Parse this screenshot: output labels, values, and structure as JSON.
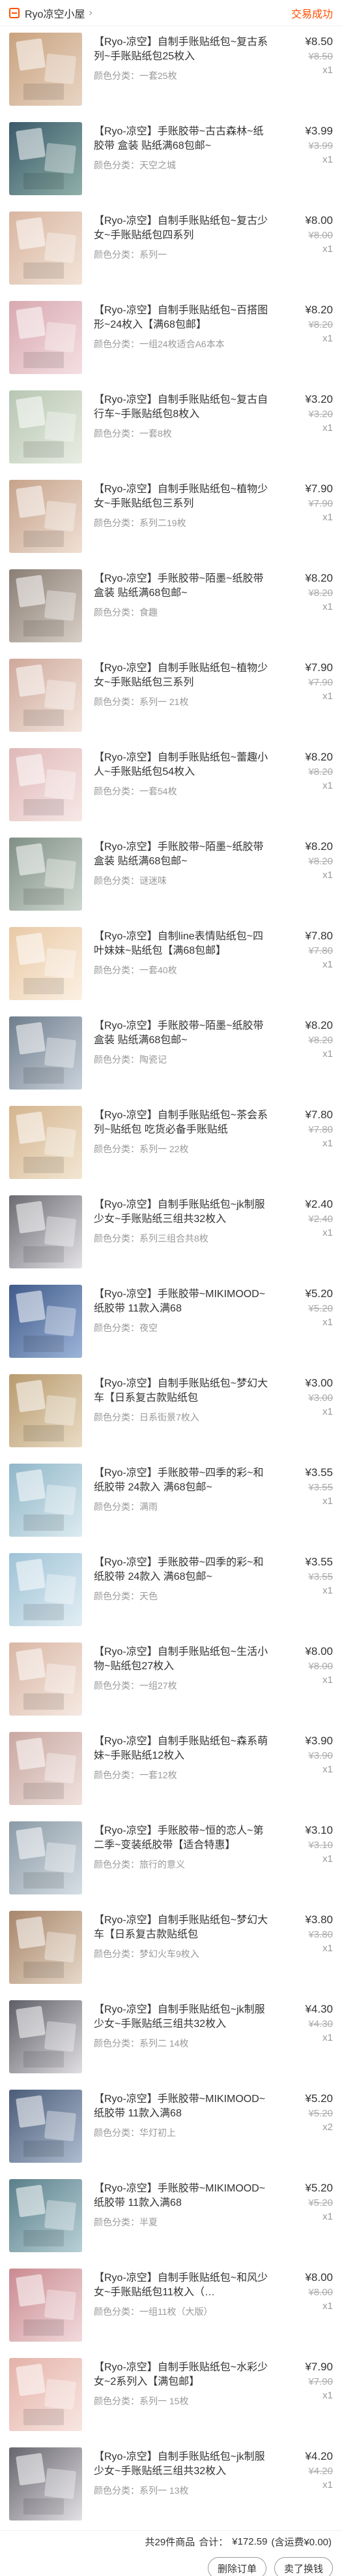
{
  "header": {
    "shop_name": "Ryo凉空小屋",
    "status": "交易成功"
  },
  "items": [
    {
      "title": "【Ryo-凉空】自制手账贴纸包~复古系列~手账贴纸包25枚入",
      "sku": "颜色分类：一套25枚",
      "price": "¥8.50",
      "orig": "¥8.50",
      "qty": "x1",
      "colors": [
        "#c9a27e",
        "#e8d5c4"
      ]
    },
    {
      "title": "【Ryo-凉空】手账胶带~古古森林~纸胶带 盒装 贴纸满68包邮~",
      "sku": "颜色分类：天空之城",
      "price": "¥3.99",
      "orig": "¥3.99",
      "qty": "x1",
      "colors": [
        "#3a5a6a",
        "#8fb0a8"
      ]
    },
    {
      "title": "【Ryo-凉空】自制手账贴纸包~复古少女~手账贴纸包四系列",
      "sku": "颜色分类：系列一",
      "price": "¥8.00",
      "orig": "¥8.00",
      "qty": "x1",
      "colors": [
        "#d9b5a0",
        "#f2e4d8"
      ]
    },
    {
      "title": "【Ryo-凉空】自制手账贴纸包~百搭图形~24枚入【满68包邮】",
      "sku": "颜色分类：一组24枚适合A6本本",
      "price": "¥8.20",
      "orig": "¥8.20",
      "qty": "x1",
      "colors": [
        "#d8a8b0",
        "#f4dfe2"
      ]
    },
    {
      "title": "【Ryo-凉空】自制手账贴纸包~复古自行车~手账贴纸包8枚入",
      "sku": "颜色分类：一套8枚",
      "price": "¥3.20",
      "orig": "¥3.20",
      "qty": "x1",
      "colors": [
        "#b7c6b2",
        "#e9ede2"
      ]
    },
    {
      "title": "【Ryo-凉空】自制手账贴纸包~植物少女~手账贴纸包三系列",
      "sku": "颜色分类：系列二19枚",
      "price": "¥7.90",
      "orig": "¥7.90",
      "qty": "x1",
      "colors": [
        "#c6a28a",
        "#efe0d4"
      ]
    },
    {
      "title": "【Ryo-凉空】手账胶带~陌墨~纸胶带盒装 贴纸满68包邮~",
      "sku": "颜色分类：食趣",
      "price": "¥8.20",
      "orig": "¥8.20",
      "qty": "x1",
      "colors": [
        "#8a7e74",
        "#d8cfc6"
      ]
    },
    {
      "title": "【Ryo-凉空】自制手账贴纸包~植物少女~手账贴纸包三系列",
      "sku": "颜色分类：系列一 21枚",
      "price": "¥7.90",
      "orig": "¥7.90",
      "qty": "x1",
      "colors": [
        "#cfa89a",
        "#f3e6de"
      ]
    },
    {
      "title": "【Ryo-凉空】自制手账贴纸包~蕾趣小人~手账贴纸包54枚入",
      "sku": "颜色分类：一套54枚",
      "price": "¥8.20",
      "orig": "¥8.20",
      "qty": "x1",
      "colors": [
        "#e0b8b8",
        "#f6e8e6"
      ]
    },
    {
      "title": "【Ryo-凉空】手账胶带~陌墨~纸胶带盒装 贴纸满68包邮~",
      "sku": "颜色分类：谜迷味",
      "price": "¥8.20",
      "orig": "¥8.20",
      "qty": "x1",
      "colors": [
        "#7f8f86",
        "#cfd8d0"
      ]
    },
    {
      "title": "【Ryo-凉空】自制line表情贴纸包~四叶妹妹~贴纸包【满68包邮】",
      "sku": "颜色分类：一套40枚",
      "price": "¥7.80",
      "orig": "¥7.80",
      "qty": "x1",
      "colors": [
        "#e9c9a6",
        "#fbf0e2"
      ]
    },
    {
      "title": "【Ryo-凉空】手账胶带~陌墨~纸胶带盒装 贴纸满68包邮~",
      "sku": "颜色分类：陶瓷记",
      "price": "¥8.20",
      "orig": "¥8.20",
      "qty": "x1",
      "colors": [
        "#6f7d8c",
        "#c9d2db"
      ]
    },
    {
      "title": "【Ryo-凉空】自制手账贴纸包~茶会系列~贴纸包 吃货必备手账贴纸",
      "sku": "颜色分类：系列一 22枚",
      "price": "¥7.80",
      "orig": "¥7.80",
      "qty": "x1",
      "colors": [
        "#d4b48e",
        "#f2e6d2"
      ]
    },
    {
      "title": "【Ryo-凉空】自制手账贴纸包~jk制服少女~手账贴纸三组共32枚入",
      "sku": "颜色分类：系列三组合共8枚",
      "price": "¥2.40",
      "orig": "¥2.40",
      "qty": "x1",
      "colors": [
        "#6b6b72",
        "#e4e2e6"
      ]
    },
    {
      "title": "【Ryo-凉空】手账胶带~MIKIMOOD~纸胶带 11款入满68",
      "sku": "颜色分类：夜空",
      "price": "¥5.20",
      "orig": "¥5.20",
      "qty": "x1",
      "colors": [
        "#3f5a8a",
        "#9db4d8"
      ]
    },
    {
      "title": "【Ryo-凉空】自制手账贴纸包~梦幻大车【日系复古款贴纸包",
      "sku": "颜色分类：日系街景7枚入",
      "price": "¥3.00",
      "orig": "¥3.00",
      "qty": "x1",
      "colors": [
        "#b89a6e",
        "#e9dcc4"
      ]
    },
    {
      "title": "【Ryo-凉空】手账胶带~四季的彩~和纸胶带 24款入 满68包邮~",
      "sku": "颜色分类：满雨",
      "price": "¥3.55",
      "orig": "¥3.55",
      "qty": "x1",
      "colors": [
        "#8fb6c8",
        "#dcebf0"
      ]
    },
    {
      "title": "【Ryo-凉空】手账胶带~四季的彩~和纸胶带 24款入 满68包邮~",
      "sku": "颜色分类：天色",
      "price": "¥3.55",
      "orig": "¥3.55",
      "qty": "x1",
      "colors": [
        "#9ec2d6",
        "#e2eef4"
      ]
    },
    {
      "title": "【Ryo-凉空】自制手账贴纸包~生活小物~贴纸包27枚入",
      "sku": "颜色分类：一组27枚",
      "price": "¥8.00",
      "orig": "¥8.00",
      "qty": "x1",
      "colors": [
        "#d9b6a4",
        "#f5e9e1"
      ]
    },
    {
      "title": "【Ryo-凉空】自制手账贴纸包~森系萌妹~手账贴纸12枚入",
      "sku": "颜色分类：一套12枚",
      "price": "¥3.90",
      "orig": "¥3.90",
      "qty": "x1",
      "colors": [
        "#c9a7a0",
        "#f0e2de"
      ]
    },
    {
      "title": "【Ryo-凉空】手账胶带~恒的恋人~第二季~变装纸胶带【适合特惠】",
      "sku": "颜色分类：旅行的意义",
      "price": "¥3.10",
      "orig": "¥3.10",
      "qty": "x1",
      "colors": [
        "#8a9aa6",
        "#d6dee4"
      ]
    },
    {
      "title": "【Ryo-凉空】自制手账贴纸包~梦幻大车【日系复古款贴纸包",
      "sku": "颜色分类：梦幻火车9枚入",
      "price": "¥3.80",
      "orig": "¥3.80",
      "qty": "x1",
      "colors": [
        "#a8866a",
        "#e6d8c8"
      ]
    },
    {
      "title": "【Ryo-凉空】自制手账贴纸包~jk制服少女~手账贴纸三组共32枚入",
      "sku": "颜色分类：系列二 14枚",
      "price": "¥4.30",
      "orig": "¥4.30",
      "qty": "x1",
      "colors": [
        "#5e5e66",
        "#e0dee2"
      ]
    },
    {
      "title": "【Ryo-凉空】手账胶带~MIKIMOOD~纸胶带 11款入满68",
      "sku": "颜色分类：华灯初上",
      "price": "¥5.20",
      "orig": "¥5.20",
      "qty": "x2",
      "colors": [
        "#4a5c78",
        "#aebcd0"
      ]
    },
    {
      "title": "【Ryo-凉空】手账胶带~MIKIMOOD~纸胶带 11款入满68",
      "sku": "颜色分类：半夏",
      "price": "¥5.20",
      "orig": "¥5.20",
      "qty": "x1",
      "colors": [
        "#5a7f8a",
        "#b8d0d6"
      ]
    },
    {
      "title": "【Ryo-凉空】自制手账贴纸包~和风少女~手账贴纸包11枚入（…",
      "sku": "颜色分类：一组11枚（大版）",
      "price": "¥8.00",
      "orig": "¥8.00",
      "qty": "x1",
      "colors": [
        "#c98a90",
        "#f2dadc"
      ]
    },
    {
      "title": "【Ryo-凉空】自制手账贴纸包~水彩少女~2系列入【满包邮】",
      "sku": "颜色分类：系列一 15枚",
      "price": "¥7.90",
      "orig": "¥7.90",
      "qty": "x1",
      "colors": [
        "#e4b2a8",
        "#f8e6e2"
      ]
    },
    {
      "title": "【Ryo-凉空】自制手账贴纸包~jk制服少女~手账贴纸三组共32枚入",
      "sku": "颜色分类：系列一 13枚",
      "price": "¥4.20",
      "orig": "¥4.20",
      "qty": "x1",
      "colors": [
        "#66646c",
        "#e2e0e4"
      ]
    }
  ],
  "summary": {
    "count_label": "共29件商品",
    "total_label": "合计：",
    "total_value": "¥172.59",
    "shipping_note": "(含运费¥0.00)"
  },
  "actions": {
    "delete_label": "删除订单",
    "resell_label": "卖了换钱"
  }
}
